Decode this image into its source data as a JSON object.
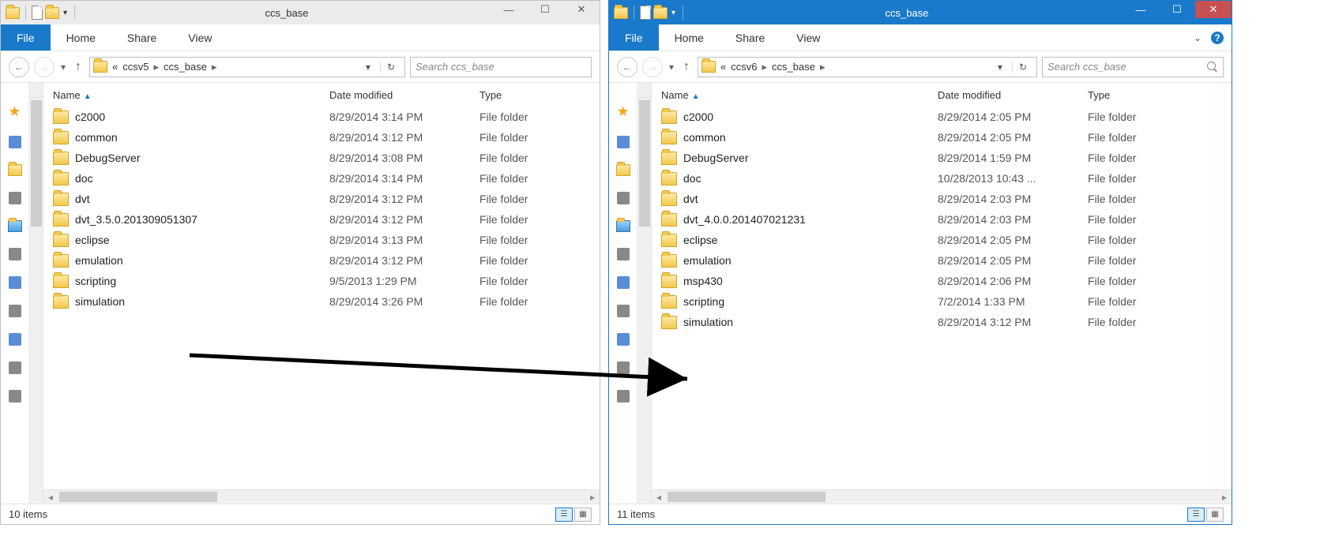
{
  "left": {
    "title": "ccs_base",
    "ribbon": {
      "file": "File",
      "tabs": [
        "Home",
        "Share",
        "View"
      ]
    },
    "breadcrumb": {
      "prefix": "«",
      "parent": "ccsv5",
      "current": "ccs_base"
    },
    "search_placeholder": "Search ccs_base",
    "columns": {
      "name": "Name",
      "date": "Date modified",
      "type": "Type"
    },
    "rows": [
      {
        "name": "c2000",
        "date": "8/29/2014 3:14 PM",
        "type": "File folder"
      },
      {
        "name": "common",
        "date": "8/29/2014 3:12 PM",
        "type": "File folder"
      },
      {
        "name": "DebugServer",
        "date": "8/29/2014 3:08 PM",
        "type": "File folder"
      },
      {
        "name": "doc",
        "date": "8/29/2014 3:14 PM",
        "type": "File folder"
      },
      {
        "name": "dvt",
        "date": "8/29/2014 3:12 PM",
        "type": "File folder"
      },
      {
        "name": "dvt_3.5.0.201309051307",
        "date": "8/29/2014 3:12 PM",
        "type": "File folder"
      },
      {
        "name": "eclipse",
        "date": "8/29/2014 3:13 PM",
        "type": "File folder"
      },
      {
        "name": "emulation",
        "date": "8/29/2014 3:12 PM",
        "type": "File folder"
      },
      {
        "name": "scripting",
        "date": "9/5/2013 1:29 PM",
        "type": "File folder"
      },
      {
        "name": "simulation",
        "date": "8/29/2014 3:26 PM",
        "type": "File folder"
      }
    ],
    "status": "10 items"
  },
  "right": {
    "title": "ccs_base",
    "ribbon": {
      "file": "File",
      "tabs": [
        "Home",
        "Share",
        "View"
      ]
    },
    "breadcrumb": {
      "prefix": "«",
      "parent": "ccsv6",
      "current": "ccs_base"
    },
    "search_placeholder": "Search ccs_base",
    "columns": {
      "name": "Name",
      "date": "Date modified",
      "type": "Type"
    },
    "rows": [
      {
        "name": "c2000",
        "date": "8/29/2014 2:05 PM",
        "type": "File folder"
      },
      {
        "name": "common",
        "date": "8/29/2014 2:05 PM",
        "type": "File folder"
      },
      {
        "name": "DebugServer",
        "date": "8/29/2014 1:59 PM",
        "type": "File folder"
      },
      {
        "name": "doc",
        "date": "10/28/2013 10:43 ...",
        "type": "File folder"
      },
      {
        "name": "dvt",
        "date": "8/29/2014 2:03 PM",
        "type": "File folder"
      },
      {
        "name": "dvt_4.0.0.201407021231",
        "date": "8/29/2014 2:03 PM",
        "type": "File folder"
      },
      {
        "name": "eclipse",
        "date": "8/29/2014 2:05 PM",
        "type": "File folder"
      },
      {
        "name": "emulation",
        "date": "8/29/2014 2:05 PM",
        "type": "File folder"
      },
      {
        "name": "msp430",
        "date": "8/29/2014 2:06 PM",
        "type": "File folder"
      },
      {
        "name": "scripting",
        "date": "7/2/2014 1:33 PM",
        "type": "File folder"
      },
      {
        "name": "simulation",
        "date": "8/29/2014 3:12 PM",
        "type": "File folder"
      }
    ],
    "status": "11 items"
  }
}
